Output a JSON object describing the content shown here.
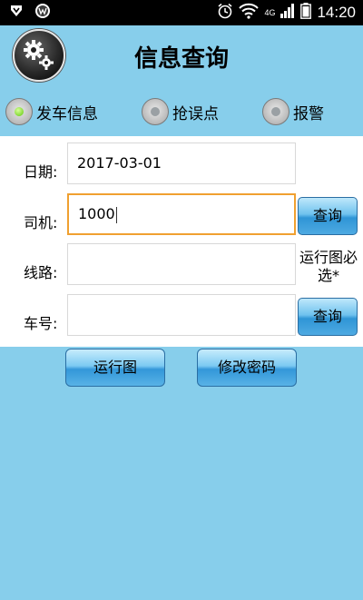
{
  "status_bar": {
    "network_label": "4G",
    "time": "14:20"
  },
  "header": {
    "title": "信息查询"
  },
  "radio_group": {
    "options": [
      {
        "label": "发车信息",
        "checked": true
      },
      {
        "label": "抢误点",
        "checked": false
      },
      {
        "label": "报警",
        "checked": false
      }
    ]
  },
  "form": {
    "date_label": "日期:",
    "date_value": "2017-03-01",
    "driver_label": "司机:",
    "driver_value": "1000",
    "route_label": "线路:",
    "route_value": "",
    "vehicle_label": "车号:",
    "vehicle_value": "",
    "query_label": "查询",
    "route_note": "运行图必选*"
  },
  "actions": {
    "schedule_label": "运行图",
    "change_password_label": "修改密码"
  },
  "colors": {
    "background": "#87ceeb",
    "focus_border": "#f0a030",
    "button_blue": "#4eaae2"
  },
  "icons": [
    "notification-shield-icon",
    "app-notification-icon",
    "alarm-clock-icon",
    "wifi-icon",
    "signal-icon",
    "battery-icon",
    "settings-gears-icon"
  ]
}
